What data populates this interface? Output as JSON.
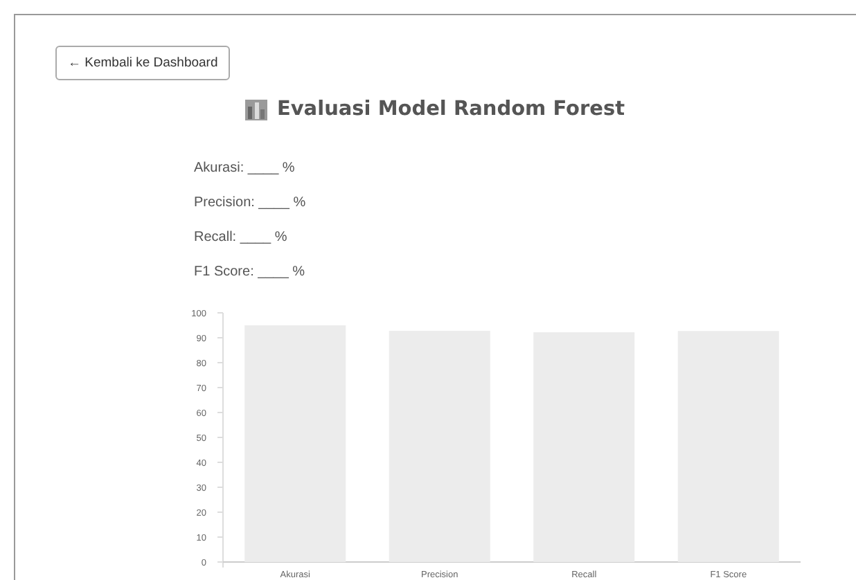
{
  "back_button": {
    "label": "← Kembali ke Dashboard"
  },
  "title": "Evaluasi Model Random Forest",
  "metrics": [
    {
      "label": "Akurasi: ____ %"
    },
    {
      "label": "Precision: ____ %"
    },
    {
      "label": "Recall: ____ %"
    },
    {
      "label": "F1 Score: ____ %"
    }
  ],
  "chart_data": {
    "type": "bar",
    "categories": [
      "Akurasi",
      "Precision",
      "Recall",
      "F1 Score"
    ],
    "series": [
      {
        "color": "#ececec",
        "values": [
          95,
          92.8,
          92.2,
          92.7
        ]
      }
    ],
    "ylim": [
      0,
      100
    ],
    "yticks": [
      0,
      10,
      20,
      30,
      40,
      50,
      60,
      70,
      80,
      90,
      100
    ]
  }
}
